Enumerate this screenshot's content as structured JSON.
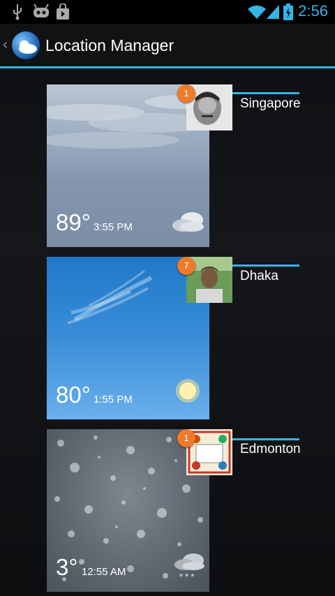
{
  "status_bar": {
    "time": "2:56",
    "icons": [
      "usb-icon",
      "android-debug-icon",
      "store-bag-icon",
      "wifi-icon",
      "signal-icon",
      "battery-charging-icon"
    ],
    "accent": "#33b5e5"
  },
  "action_bar": {
    "title": "Location Manager",
    "app_icon": "weather-globe-icon",
    "up_icon": "chevron-left-icon",
    "accent": "#33b5e5"
  },
  "locations": [
    {
      "name": "Singapore",
      "temperature": "89°",
      "time": "3:55 PM",
      "badge": "1",
      "condition_icon": "cloudy-icon",
      "background": "overcast"
    },
    {
      "name": "Dhaka",
      "temperature": "80°",
      "time": "1:55 PM",
      "badge": "7",
      "condition_icon": "sunny-icon",
      "background": "clear-sky"
    },
    {
      "name": "Edmonton",
      "temperature": "3°",
      "time": "12:55 AM",
      "badge": "1",
      "condition_icon": "snow-cloud-icon",
      "background": "snowfall"
    }
  ],
  "colors": {
    "badge": "#f07a2a",
    "accent": "#33b5e5"
  }
}
